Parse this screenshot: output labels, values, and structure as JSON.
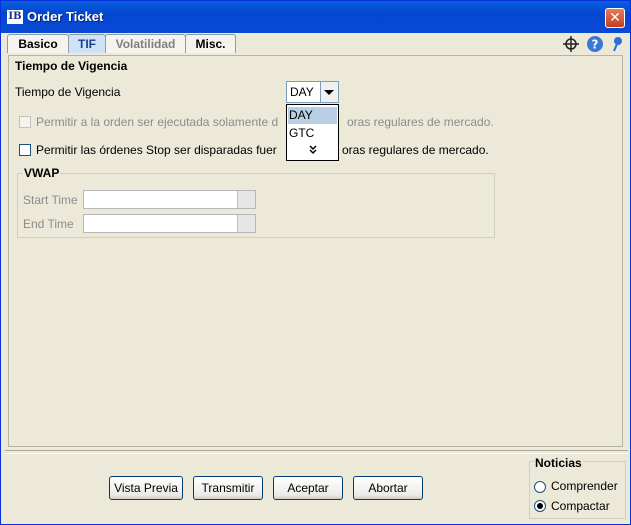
{
  "window": {
    "title": "Order Ticket",
    "app_icon_text": "IB",
    "close_symbol": "✕"
  },
  "tabs": [
    {
      "label": "Basico",
      "state": "normal"
    },
    {
      "label": "TIF",
      "state": "active"
    },
    {
      "label": "Volatilidad",
      "state": "disabled"
    },
    {
      "label": "Misc.",
      "state": "normal"
    }
  ],
  "toolbar_icons": [
    "crosshair-icon",
    "help-icon",
    "pin-icon"
  ],
  "tif_section": {
    "title": "Tiempo de Vigencia",
    "field_label": "Tiempo de Vigencia",
    "selected": "DAY",
    "dropdown_options": [
      "DAY",
      "GTC"
    ],
    "more_symbol": "⌄",
    "checkbox_rth": {
      "label": "Permitir a la orden ser ejecutada solamente d",
      "label_tail": "oras regulares de mercado.",
      "checked": false,
      "enabled": false
    },
    "checkbox_stop": {
      "label": "Permitir las órdenes Stop ser disparadas fuer",
      "label_tail": "oras regulares de mercado.",
      "checked": false,
      "enabled": true
    }
  },
  "vwap": {
    "title": "VWAP",
    "start_time_label": "Start Time",
    "end_time_label": "End Time",
    "start_time_value": "",
    "end_time_value": ""
  },
  "buttons": {
    "preview": "Vista Previa",
    "transmit": "Transmitir",
    "accept": "Aceptar",
    "abort": "Abortar"
  },
  "news": {
    "title": "Noticias",
    "options": [
      "Comprender",
      "Compactar"
    ],
    "selected": "Compactar"
  },
  "colors": {
    "titlebar": "#0a5fe0",
    "active_tab": "#cfe3f7",
    "dropdown_selection": "#b8cfe5",
    "background": "#ece9d8"
  }
}
